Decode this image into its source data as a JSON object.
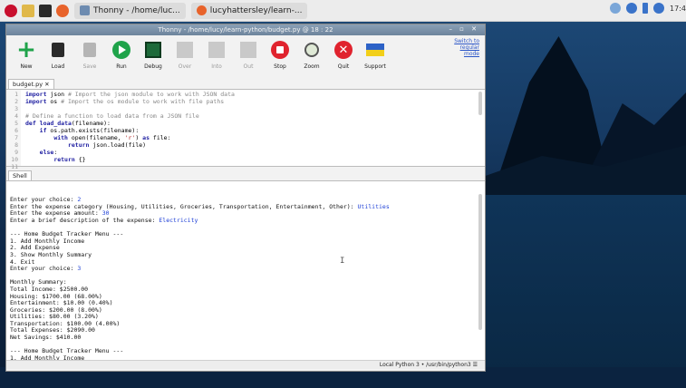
{
  "taskbar": {
    "apps": [
      {
        "label": "Thonny - /home/luc..."
      },
      {
        "label": "lucyhattersley/learn-..."
      }
    ],
    "clock": "17:4"
  },
  "window": {
    "title": "Thonny - /home/lucy/learn-python/budget.py @ 18 : 22",
    "controls": "– ▫ ✕"
  },
  "toolbar": {
    "new": "New",
    "load": "Load",
    "save": "Save",
    "run": "Run",
    "debug": "Debug",
    "over": "Over",
    "into": "Into",
    "out": "Out",
    "stop": "Stop",
    "zoom": "Zoom",
    "quit": "Quit",
    "support": "Support",
    "switch_mode": [
      "Switch to",
      "regular",
      "mode"
    ]
  },
  "editor": {
    "tab": "budget.py ✕",
    "line_numbers": [
      "1",
      "2",
      "3",
      "4",
      "5",
      "6",
      "7",
      "8",
      "9",
      "10",
      "11"
    ]
  },
  "shell": {
    "tab": "Shell",
    "lines": [
      {
        "t": "Enter your choice: ",
        "in": "2"
      },
      {
        "t": "Enter the expense category (Housing, Utilities, Groceries, Transportation, Entertainment, Other): ",
        "in": "Utilities"
      },
      {
        "t": "Enter the expense amount: ",
        "in": "30"
      },
      {
        "t": "Enter a brief description of the expense: ",
        "in": "Electricity"
      },
      {
        "t": "",
        "in": ""
      },
      {
        "t": "--- Home Budget Tracker Menu ---",
        "in": ""
      },
      {
        "t": "1. Add Monthly Income",
        "in": ""
      },
      {
        "t": "2. Add Expense",
        "in": ""
      },
      {
        "t": "3. Show Monthly Summary",
        "in": ""
      },
      {
        "t": "4. Exit",
        "in": ""
      },
      {
        "t": "Enter your choice: ",
        "in": "3"
      },
      {
        "t": "",
        "in": ""
      },
      {
        "t": "Monthly Summary:",
        "in": ""
      },
      {
        "t": "Total Income: $2500.00",
        "in": ""
      },
      {
        "t": "Housing: $1700.00 (68.00%)",
        "in": ""
      },
      {
        "t": "Entertainment: $10.00 (0.40%)",
        "in": ""
      },
      {
        "t": "Groceries: $200.00 (8.00%)",
        "in": ""
      },
      {
        "t": "Utilities: $80.00 (3.20%)",
        "in": ""
      },
      {
        "t": "Transportation: $100.00 (4.00%)",
        "in": ""
      },
      {
        "t": "Total Expenses: $2090.00",
        "in": ""
      },
      {
        "t": "Net Savings: $410.00",
        "in": ""
      },
      {
        "t": "",
        "in": ""
      },
      {
        "t": "--- Home Budget Tracker Menu ---",
        "in": ""
      },
      {
        "t": "1. Add Monthly Income",
        "in": ""
      },
      {
        "t": "2. Add Expense",
        "in": ""
      },
      {
        "t": "3. Show Monthly Summary",
        "in": ""
      },
      {
        "t": "4. Exit",
        "in": ""
      },
      {
        "t": "Enter your choice:",
        "in": ""
      }
    ]
  },
  "status": "Local Python 3 • /usr/bin/python3 ☰",
  "colors": {
    "accent_green": "#1fa34a",
    "stop_red": "#e0232e",
    "code_keyword": "#1c1ca0",
    "shell_input": "#1c3ed6"
  }
}
